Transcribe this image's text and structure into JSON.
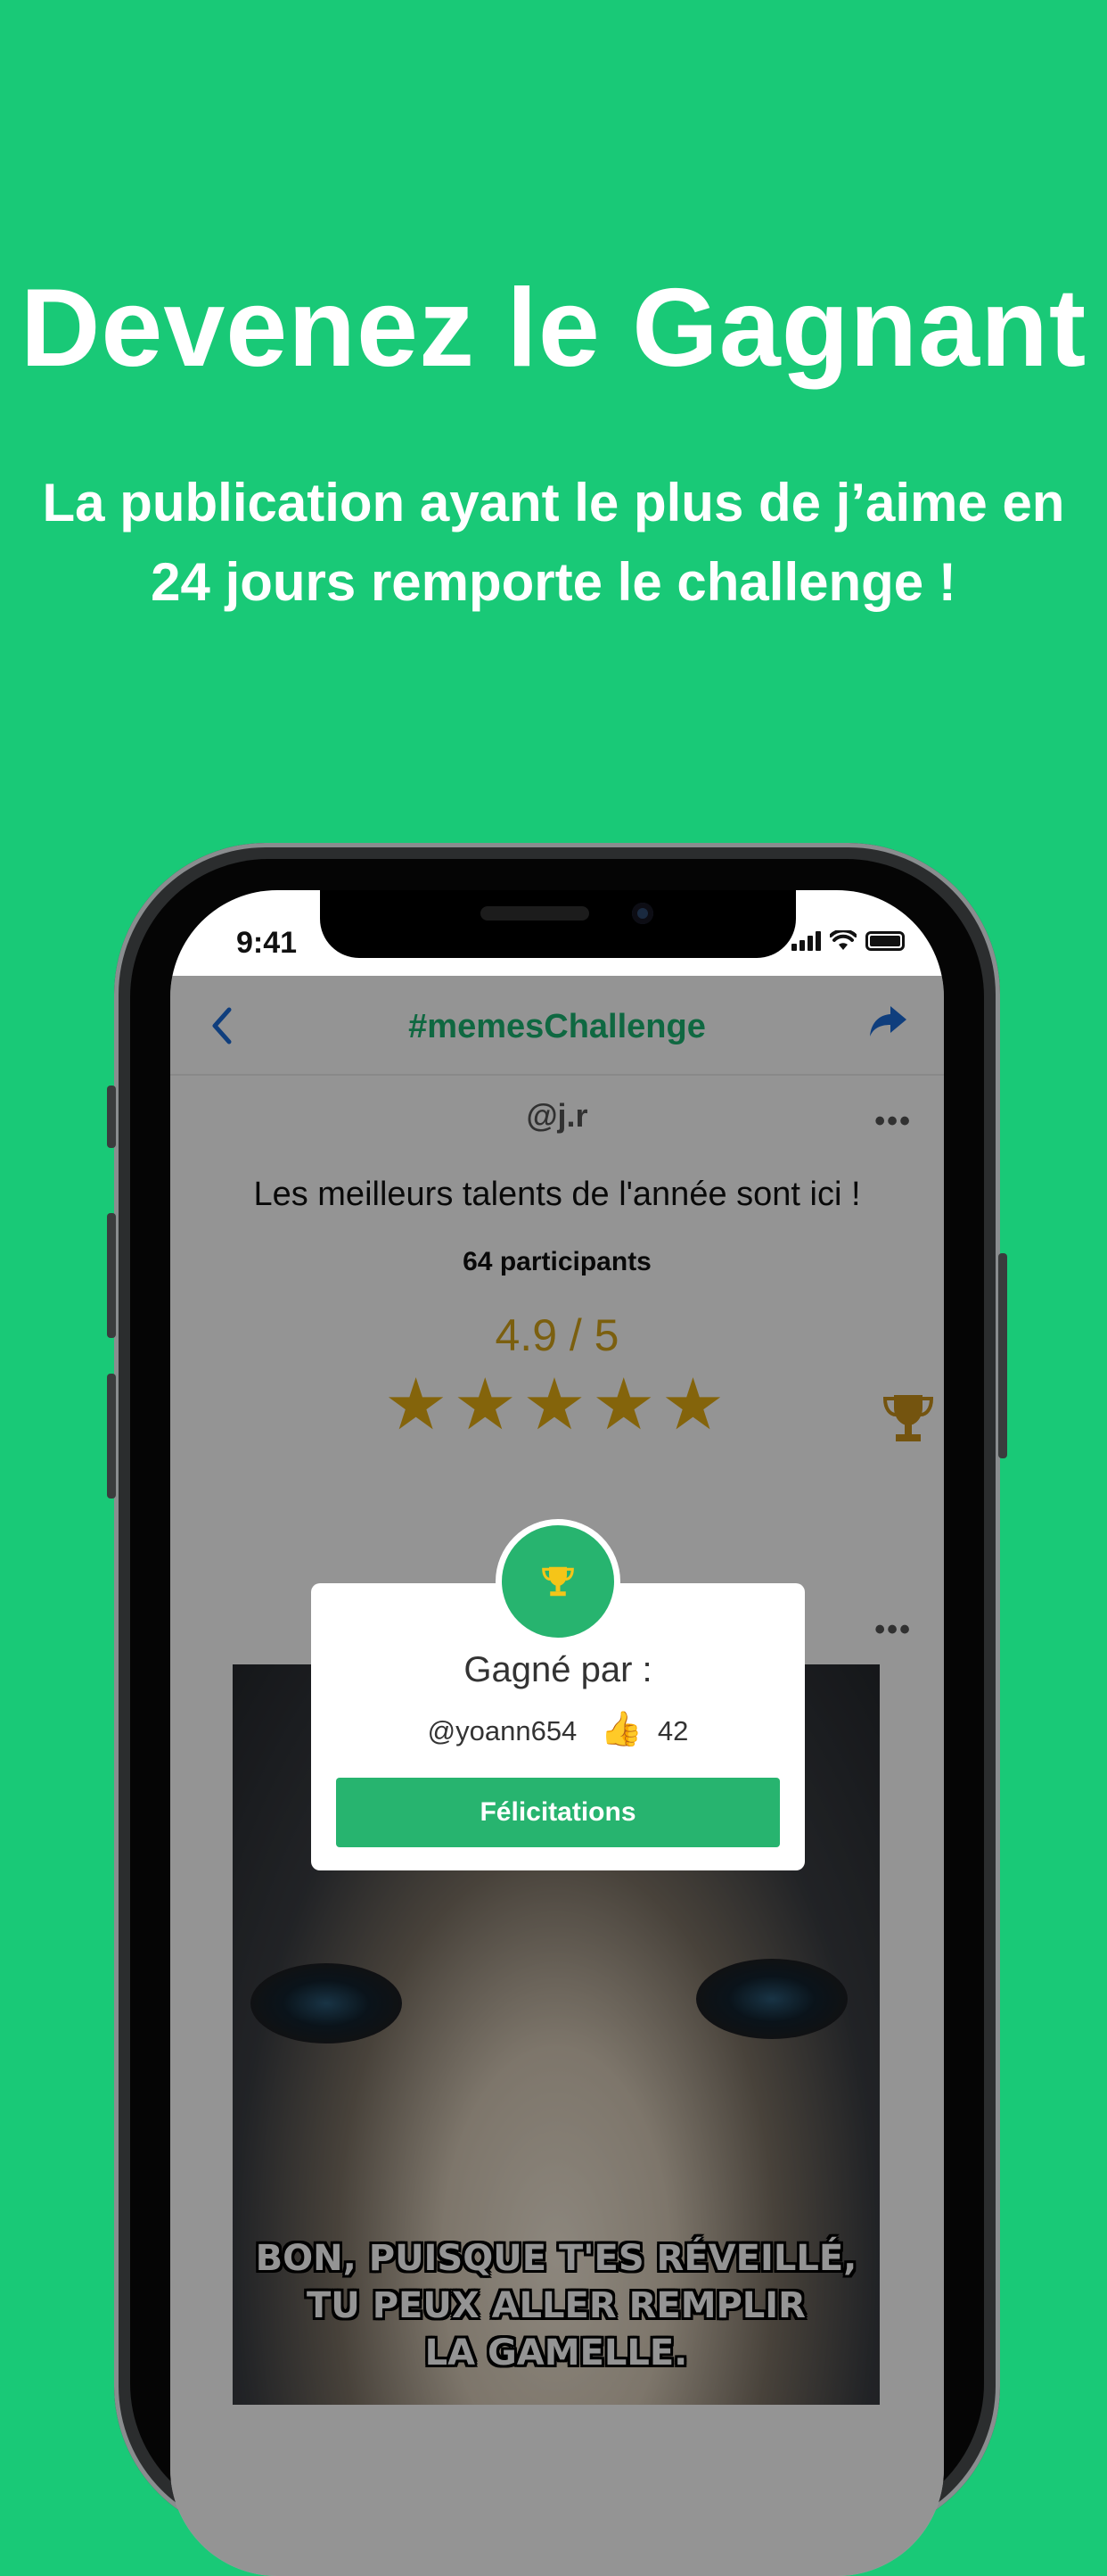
{
  "promo": {
    "headline": "Devenez le Gagnant",
    "subline": "La publication ayant le plus de j’aime en 24 jours remporte le challenge !",
    "background_color": "#19c977"
  },
  "status_bar": {
    "time": "9:41"
  },
  "navbar": {
    "back_icon": "chevron-left-icon",
    "title": "#memesChallenge",
    "share_icon": "share-arrow-icon"
  },
  "challenge": {
    "author": "@j.r",
    "more_icon": "ellipsis-icon",
    "description": "Les meilleurs talents de l'année sont ici !",
    "participants": "64 participants",
    "rating_text": "4.9 / 5",
    "stars": "★★★★★",
    "stars_value": 5,
    "trophy_icon": "trophy-icon"
  },
  "post": {
    "more_icon": "ellipsis-icon",
    "meme_text_line1": "Bon, puisque t'es réveillé,",
    "meme_text_line2": "tu peux aller remplir",
    "meme_text_line3": "la gamelle."
  },
  "winner_modal": {
    "badge_icon": "trophy-icon",
    "title": "Gagné par :",
    "winner_handle": "@yoann654",
    "like_icon": "👍",
    "likes": "42",
    "button_label": "Félicitations",
    "accent_color": "#27b46f"
  }
}
